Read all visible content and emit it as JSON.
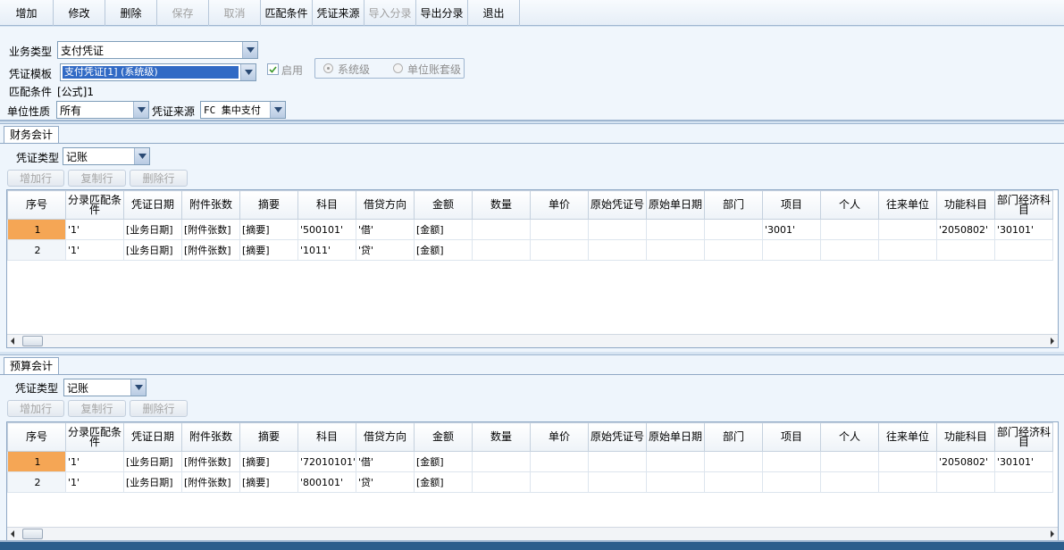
{
  "toolbar": {
    "add": "增加",
    "edit": "修改",
    "delete": "删除",
    "save": "保存",
    "cancel": "取消",
    "match": "匹配条件",
    "source": "凭证来源",
    "import": "导入分录",
    "export": "导出分录",
    "exit": "退出"
  },
  "form": {
    "business_type_label": "业务类型",
    "business_type_value": "支付凭证",
    "template_label": "凭证模板",
    "template_value": "支付凭证[1] (系统级)",
    "enabled_label": "启用",
    "enabled": true,
    "level_system": "系统级",
    "level_unit": "单位账套级",
    "match_label": "匹配条件",
    "match_value": "[公式]1",
    "unit_nature_label": "单位性质",
    "unit_nature_value": "所有",
    "source_label": "凭证来源",
    "source_value": "FC 集中支付"
  },
  "columns": [
    "序号",
    "分录匹配条件",
    "凭证日期",
    "附件张数",
    "摘要",
    "科目",
    "借贷方向",
    "金额",
    "数量",
    "单价",
    "原始凭证号",
    "原始单日期",
    "部门",
    "项目",
    "个人",
    "往来单位",
    "功能科目",
    "部门经济科目"
  ],
  "grid_buttons": {
    "add_row": "增加行",
    "copy_row": "复制行",
    "delete_row": "删除行"
  },
  "finance": {
    "tab": "财务会计",
    "type_label": "凭证类型",
    "type_value": "记账",
    "rows": [
      [
        "1",
        "'1'",
        "[业务日期]",
        "[附件张数]",
        "[摘要]",
        "'500101'",
        "'借'",
        "[金额]",
        "",
        "",
        "",
        "",
        "",
        "'3001'",
        "",
        "",
        "'2050802'",
        "'30101'"
      ],
      [
        "2",
        "'1'",
        "[业务日期]",
        "[附件张数]",
        "[摘要]",
        "'1011'",
        "'贷'",
        "[金额]",
        "",
        "",
        "",
        "",
        "",
        "",
        "",
        "",
        "",
        ""
      ]
    ]
  },
  "budget": {
    "tab": "预算会计",
    "type_label": "凭证类型",
    "type_value": "记账",
    "rows": [
      [
        "1",
        "'1'",
        "[业务日期]",
        "[附件张数]",
        "[摘要]",
        "'72010101'",
        "'借'",
        "[金额]",
        "",
        "",
        "",
        "",
        "",
        "",
        "",
        "",
        "'2050802'",
        "'30101'"
      ],
      [
        "2",
        "'1'",
        "[业务日期]",
        "[附件张数]",
        "[摘要]",
        "'800101'",
        "'贷'",
        "[金额]",
        "",
        "",
        "",
        "",
        "",
        "",
        "",
        "",
        "",
        ""
      ]
    ]
  },
  "colors": {
    "accent": "#316ac5",
    "current_row": "#f5a655",
    "status_bar": "#2c5e8c"
  }
}
